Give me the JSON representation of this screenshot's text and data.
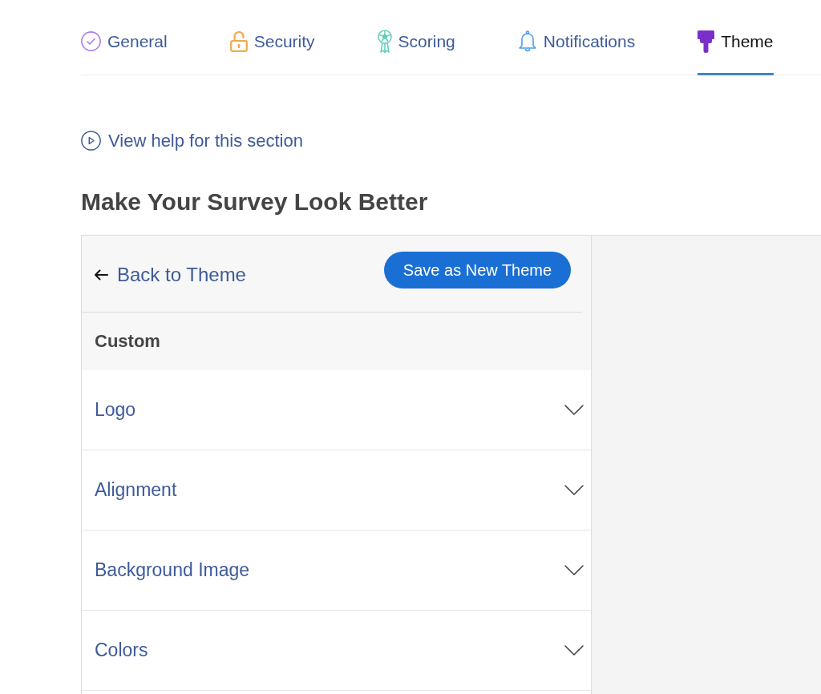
{
  "tabs": [
    {
      "label": "General",
      "selected": false,
      "color": "#a87cf0"
    },
    {
      "label": "Security",
      "selected": false,
      "color": "#f5a94a"
    },
    {
      "label": "Scoring",
      "selected": false,
      "color": "#5fcdb6"
    },
    {
      "label": "Notifications",
      "selected": false,
      "color": "#4e9ee8"
    },
    {
      "label": "Theme",
      "selected": true,
      "color": "#7b2fc9"
    }
  ],
  "help_link": "View help for this section",
  "heading": "Make Your Survey Look Better",
  "panel": {
    "back_link": "Back to Theme",
    "save_button": "Save as New Theme",
    "section_title": "Custom",
    "sections": [
      {
        "label": "Logo",
        "expanded": false
      },
      {
        "label": "Alignment",
        "expanded": false
      },
      {
        "label": "Background Image",
        "expanded": false
      },
      {
        "label": "Colors",
        "expanded": false
      }
    ]
  }
}
